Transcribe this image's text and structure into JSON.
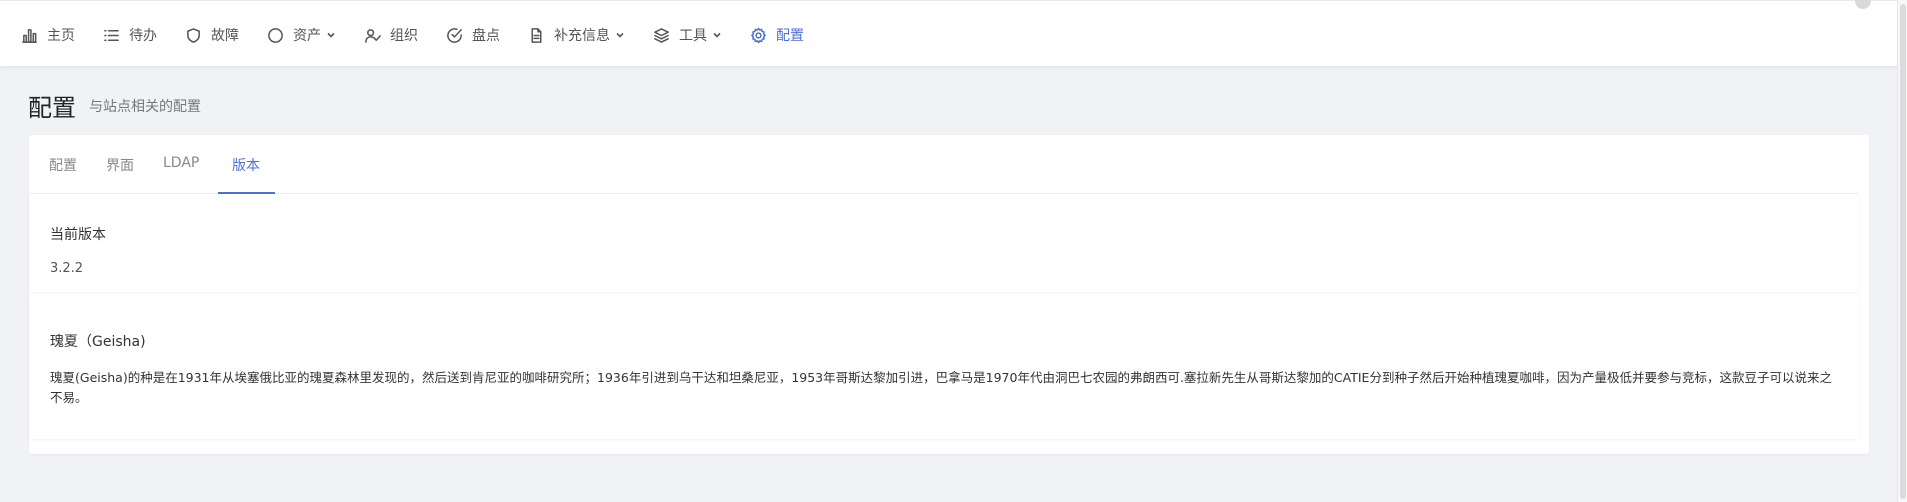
{
  "nav": {
    "items": [
      {
        "id": "home",
        "label": "主页",
        "icon": "bar-chart-icon"
      },
      {
        "id": "todo",
        "label": "待办",
        "icon": "list-icon"
      },
      {
        "id": "fault",
        "label": "故障",
        "icon": "shield-icon"
      },
      {
        "id": "asset",
        "label": "资产",
        "icon": "circle-icon",
        "dropdown": true
      },
      {
        "id": "org",
        "label": "组织",
        "icon": "user-check-icon"
      },
      {
        "id": "inventory",
        "label": "盘点",
        "icon": "check-circle-icon"
      },
      {
        "id": "supplement",
        "label": "补充信息",
        "icon": "file-text-icon",
        "dropdown": true
      },
      {
        "id": "tools",
        "label": "工具",
        "icon": "layers-icon",
        "dropdown": true
      },
      {
        "id": "config",
        "label": "配置",
        "icon": "gear-icon",
        "active": true
      }
    ],
    "active_color": "#4f6fd8"
  },
  "page": {
    "title": "配置",
    "subtitle": "与站点相关的配置"
  },
  "tabs": {
    "items": [
      "配置",
      "界面",
      "LDAP",
      "版本"
    ],
    "active_index": 3
  },
  "version_section": {
    "title": "当前版本",
    "value": "3.2.2"
  },
  "geisha_section": {
    "title": "瑰夏（Geisha)",
    "body": "瑰夏(Geisha)的种是在1931年从埃塞俄比亚的瑰夏森林里发现的，然后送到肯尼亚的咖啡研究所；1936年引进到乌干达和坦桑尼亚，1953年哥斯达黎加引进，巴拿马是1970年代由洞巴七农园的弗朗西可.塞拉新先生从哥斯达黎加的CATIE分到种子然后开始种植瑰夏咖啡，因为产量极低并要参与竞标，这款豆子可以说来之不易。"
  }
}
